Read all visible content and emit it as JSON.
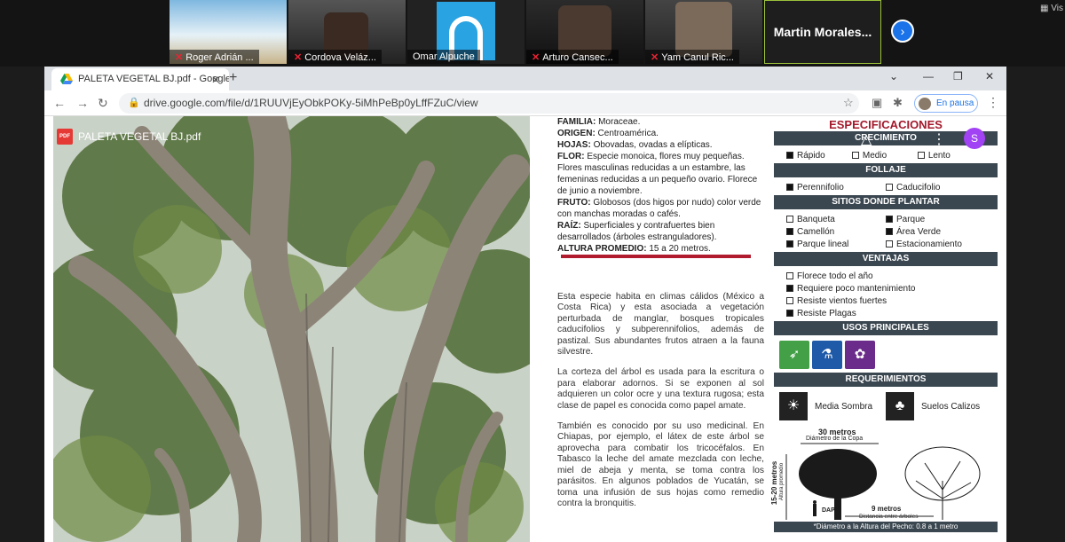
{
  "zoom": {
    "participants": [
      {
        "name": "Roger Adrián ..."
      },
      {
        "name": "Cordova Veláz..."
      },
      {
        "name": "Omar Alpuche"
      },
      {
        "name": "Arturo Cansec..."
      },
      {
        "name": "Yam Canul Ric..."
      }
    ],
    "active_speaker": "Martin  Morales...",
    "view_label": "Vis"
  },
  "browser": {
    "tab_title": "PALETA VEGETAL BJ.pdf - Google",
    "url": "drive.google.com/file/d/1RUUVjEyObkPOKy-5iMhPeBp0yLffFZuC/view",
    "profile_label": "En pausa"
  },
  "viewer": {
    "file_name": "PALETA VEGETAL BJ.pdf",
    "account_initial": "S"
  },
  "doc": {
    "facts": [
      {
        "label": "FAMILIA:",
        "text": " Moraceae."
      },
      {
        "label": "ORIGEN:",
        "text": " Centroamérica."
      },
      {
        "label": "HOJAS:",
        "text": " Obovadas, ovadas a elípticas."
      },
      {
        "label": "FLOR:",
        "text": " Especie monoica, flores muy pequeñas. Flores masculinas reducidas a un estambre, las femeninas reducidas a un pequeño ovario. Florece de junio a noviembre."
      },
      {
        "label": "FRUTO:",
        "text": " Globosos (dos higos por nudo) color verde con manchas moradas o cafés."
      },
      {
        "label": "RAÍZ:",
        "text": " Superficiales y contrafuertes bien desarrollados (árboles estranguladores)."
      },
      {
        "label": "ALTURA PROMEDIO:",
        "text": " 15 a 20 metros."
      }
    ],
    "paragraphs": [
      "Esta especie habita en climas cálidos (México a Costa Rica) y esta asociada a vegetación perturbada de manglar, bosques tropicales caducifolios y subperennifolios, además de pastizal. Sus abundantes frutos atraen a la fauna silvestre.",
      "La corteza del árbol es usada para la escritura o para elaborar adornos. Si se exponen al sol adquieren un color ocre y una textura rugosa; esta clase de papel es conocida como papel amate.",
      "También es conocido por su uso medicinal. En Chiapas, por ejemplo, el látex de este árbol se aprovecha para combatir los tricocéfalos. En Tabasco la leche del amate mezclada con leche, miel de abeja y menta, se toma contra los parásitos. En algunos poblados de Yucatán, se toma una infusión de sus hojas como remedio contra la bronquitis."
    ],
    "specs": {
      "title": "ESPECIFICACIONES",
      "crecimiento": {
        "heading": "CRECIMIENTO",
        "options": [
          {
            "label": "Rápido",
            "on": true
          },
          {
            "label": "Medio",
            "on": false
          },
          {
            "label": "Lento",
            "on": false
          }
        ]
      },
      "follaje": {
        "heading": "FOLLAJE",
        "options": [
          {
            "label": "Perennifolio",
            "on": true
          },
          {
            "label": "Caducifolio",
            "on": false
          }
        ]
      },
      "sitios": {
        "heading": "SITIOS DONDE PLANTAR",
        "options": [
          {
            "label": "Banqueta",
            "on": false
          },
          {
            "label": "Parque",
            "on": true
          },
          {
            "label": "Camellón",
            "on": true
          },
          {
            "label": "Área Verde",
            "on": true
          },
          {
            "label": "Parque lineal",
            "on": true
          },
          {
            "label": "Estacionamiento",
            "on": false
          }
        ]
      },
      "ventajas": {
        "heading": "VENTAJAS",
        "options": [
          {
            "label": "Florece todo el año",
            "on": false
          },
          {
            "label": "Requiere poco mantenimiento",
            "on": true
          },
          {
            "label": "Resiste vientos fuertes",
            "on": false
          },
          {
            "label": "Resiste Plagas",
            "on": true
          }
        ]
      },
      "usos": {
        "heading": "USOS PRINCIPALES"
      },
      "requerimientos": {
        "heading": "REQUERIMIENTOS",
        "items": [
          {
            "label": "Media Sombra"
          },
          {
            "label": "Suelos Calizos"
          }
        ]
      },
      "dimensions": {
        "copa_value": "30 metros",
        "copa_label": "Diámetro de la Copa",
        "altura_value": "15-20 metros",
        "altura_label": "Altura promedio",
        "distancia_value": "9 metros",
        "distancia_label": "Distancia entre árboles",
        "dap_label": "DAP",
        "footnote": "*Diámetro a la Altura del Pecho: 0.8 a 1 metro"
      }
    }
  },
  "colors": {
    "accent_red": "#a3192b",
    "bar_dark": "#3b4750",
    "use_green": "#43a047",
    "use_blue": "#1e5aa8",
    "use_purple": "#6a2b8a"
  }
}
